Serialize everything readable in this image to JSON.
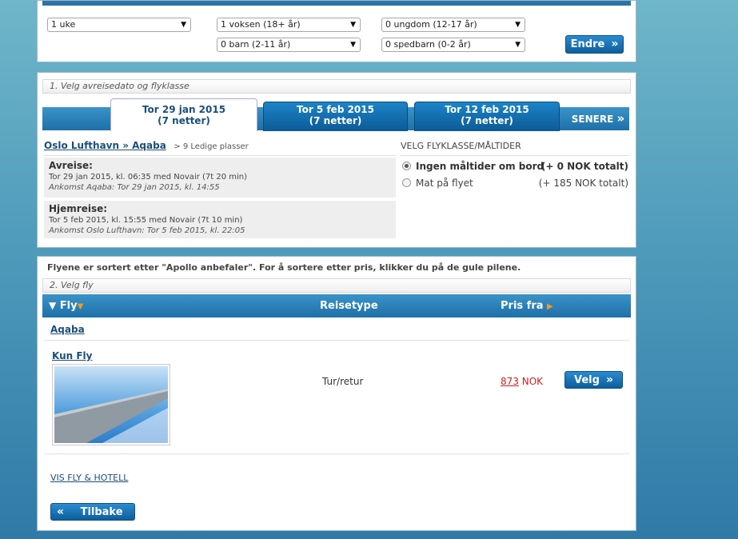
{
  "filters": {
    "duration": "1 uke",
    "adults": "1 voksen (18+ år)",
    "youth": "0 ungdom (12-17 år)",
    "children": "0 barn (2-11 år)",
    "infants": "0 spedbarn (0-2 år)",
    "change_button": "Endre",
    "chevron": "»"
  },
  "step1": {
    "label": "1. Velg avreisedato og flyklasse",
    "tabs": [
      {
        "date": "Tor 29 jan 2015",
        "nights": "(7 netter)"
      },
      {
        "date": "Tor 5 feb 2015",
        "nights": "(7 netter)"
      },
      {
        "date": "Tor 12 feb 2015",
        "nights": "(7 netter)"
      }
    ],
    "later": "SENERE",
    "later_chevron": "»",
    "route": "Oslo Lufthavn » Aqaba",
    "seats": "> 9 Ledige plasser",
    "outbound": {
      "title": "Avreise:",
      "detail": "Tor 29 jan 2015, kl. 06:35 med Novair (7t 20 min)",
      "arrival": "Ankomst Aqaba: Tor 29 jan 2015, kl. 14:55"
    },
    "return": {
      "title": "Hjemreise:",
      "detail": "Tor 5 feb 2015, kl. 15:55 med Novair (7t 10 min)",
      "arrival": "Ankomst Oslo Lufthavn: Tor 5 feb 2015, kl. 22:05"
    },
    "class_heading": "VELG FLYKLASSE/MÅLTIDER",
    "options": [
      {
        "label": "Ingen måltider om bord",
        "price": "(+ 0 NOK totalt)",
        "selected": true
      },
      {
        "label": "Mat på flyet",
        "price": "(+ 185 NOK totalt)",
        "selected": false
      }
    ]
  },
  "step2": {
    "sort_note": "Flyene er sortert etter \"Apollo anbefaler\". For å sortere etter pris, klikker du på de gule pilene.",
    "label": "2. Velg fly",
    "columns": {
      "fly": "Fly",
      "type": "Reisetype",
      "price": "Pris fra"
    },
    "destination": "Aqaba",
    "product": "Kun Fly",
    "trip_type": "Tur/retur",
    "price_value": "873",
    "currency": "NOK",
    "select_button": "Velg",
    "chevron": "»",
    "hotel_link": "VIS FLY & HOTELL",
    "back_button": "Tilbake",
    "back_chevron": "«"
  },
  "colors": {
    "accent": "#1e70a8",
    "price": "#c82020",
    "sort_arrow": "#f39a1e"
  },
  "icons": [
    "chevron-down-icon",
    "sort-arrow-icon",
    "chevron-right-icon",
    "radio-icon"
  ]
}
